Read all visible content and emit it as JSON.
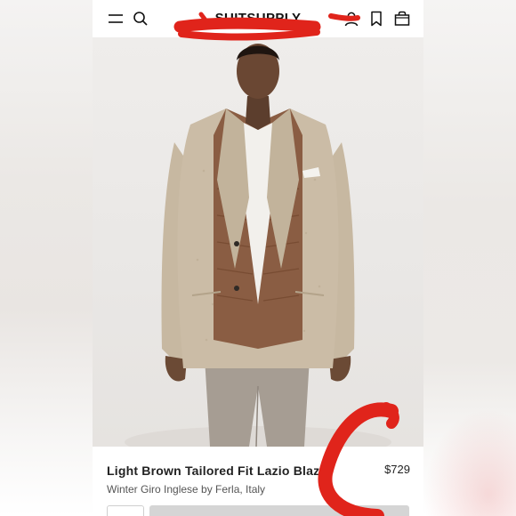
{
  "header": {
    "brand": "SUITSUPPLY",
    "icons": [
      "menu-icon",
      "search-icon",
      "account-icon",
      "bookmark-icon",
      "bag-icon"
    ]
  },
  "product": {
    "name": "Light Brown Tailored Fit Lazio Blazer",
    "price": "$729",
    "fabric": "Winter Giro Inglese by Ferla, Italy"
  },
  "colors": {
    "scribble": "#e0241b",
    "blazer": "#cbbca6",
    "vest": "#8a5d43",
    "trousers": "#a69d93"
  }
}
